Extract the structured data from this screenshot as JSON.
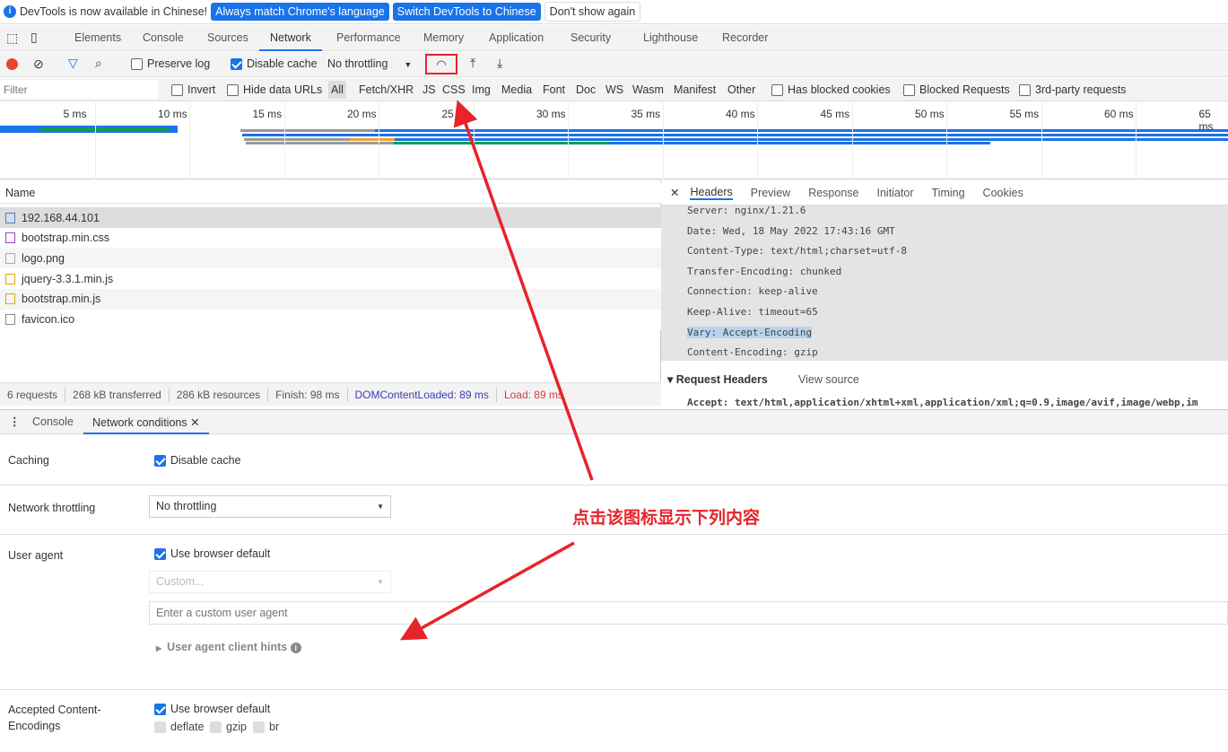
{
  "infobar": {
    "message": "DevTools is now available in Chinese!",
    "match_language": "Always match Chrome's language",
    "switch_language": "Switch DevTools to Chinese",
    "dont_show": "Don't show again"
  },
  "tabs": [
    "Elements",
    "Console",
    "Sources",
    "Network",
    "Performance",
    "Memory",
    "Application",
    "Security",
    "Lighthouse",
    "Recorder"
  ],
  "active_tab": "Network",
  "toolbar": {
    "preserve_log": "Preserve log",
    "preserve_log_checked": false,
    "disable_cache": "Disable cache",
    "disable_cache_checked": true,
    "throttling": "No throttling"
  },
  "filter": {
    "placeholder": "Filter",
    "invert": "Invert",
    "hide_data_urls": "Hide data URLs",
    "types": [
      "All",
      "Fetch/XHR",
      "JS",
      "CSS",
      "Img",
      "Media",
      "Font",
      "Doc",
      "WS",
      "Wasm",
      "Manifest",
      "Other"
    ],
    "has_blocked_cookies": "Has blocked cookies",
    "blocked_requests": "Blocked Requests",
    "third_party": "3rd-party requests"
  },
  "overview": {
    "ticks": [
      "5 ms",
      "10 ms",
      "15 ms",
      "20 ms",
      "25 ms",
      "30 ms",
      "35 ms",
      "40 ms",
      "45 ms",
      "50 ms",
      "55 ms",
      "60 ms",
      "65 ms"
    ]
  },
  "requests": {
    "header": "Name",
    "items": [
      {
        "name": "192.168.44.101",
        "type": "document"
      },
      {
        "name": "bootstrap.min.css",
        "type": "stylesheet"
      },
      {
        "name": "logo.png",
        "type": "image"
      },
      {
        "name": "jquery-3.3.1.min.js",
        "type": "script"
      },
      {
        "name": "bootstrap.min.js",
        "type": "script"
      },
      {
        "name": "favicon.ico",
        "type": "other"
      }
    ]
  },
  "details": {
    "tabs": [
      "Headers",
      "Preview",
      "Response",
      "Initiator",
      "Timing",
      "Cookies"
    ],
    "active": "Headers",
    "response_headers": [
      "Server: nginx/1.21.6",
      "Date: Wed, 18 May 2022 17:43:16 GMT",
      "Content-Type: text/html;charset=utf-8",
      "Transfer-Encoding: chunked",
      "Connection: keep-alive",
      "Keep-Alive: timeout=65",
      "Vary: Accept-Encoding",
      "Content-Encoding: gzip"
    ],
    "request_headers_title": "Request Headers",
    "view_source": "View source",
    "accept": "Accept: text/html,application/xhtml+xml,application/xml;q=0.9,image/avif,image/webp,im"
  },
  "status": {
    "requests": "6 requests",
    "transferred": "268 kB transferred",
    "resources": "286 kB resources",
    "finish": "Finish: 98 ms",
    "dcl": "DOMContentLoaded: 89 ms",
    "load": "Load: 89 ms"
  },
  "drawer": {
    "tabs": [
      "Console",
      "Network conditions"
    ],
    "active": "Network conditions"
  },
  "network_conditions": {
    "caching_label": "Caching",
    "disable_cache": "Disable cache",
    "throttling_label": "Network throttling",
    "throttling_value": "No throttling",
    "ua_label": "User agent",
    "ua_default": "Use browser default",
    "ua_custom": "Custom...",
    "ua_placeholder": "Enter a custom user agent",
    "ua_hints": "User agent client hints",
    "enc_label": "Accepted Content-Encodings",
    "enc_default": "Use browser default",
    "encodings": [
      "deflate",
      "gzip",
      "br"
    ]
  },
  "annotation": {
    "text": "点击该图标显示下列内容",
    "color": "#e8232a"
  },
  "colors": {
    "accent": "#1a73e8",
    "dcl": "#3b3bb5",
    "load": "#d23b3b"
  }
}
